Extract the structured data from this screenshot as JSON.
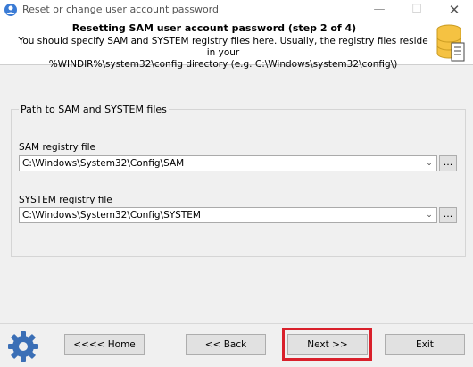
{
  "window": {
    "title": "Reset or change user account password",
    "minimize_symbol": "—",
    "maximize_symbol": "☐",
    "close_symbol": "✕"
  },
  "header": {
    "title": "Resetting SAM user account password (step 2 of 4)",
    "description_line1": "You should specify SAM and SYSTEM registry files here. Usually, the registry files reside in your",
    "description_line2": "%WINDIR%\\system32\\config directory (e.g. C:\\Windows\\system32\\config\\)"
  },
  "group": {
    "legend": "Path to SAM and SYSTEM files",
    "sam": {
      "label": "SAM registry file",
      "value": "C:\\Windows\\System32\\Config\\SAM",
      "browse": "..."
    },
    "system": {
      "label": "SYSTEM registry file",
      "value": "C:\\Windows\\System32\\Config\\SYSTEM",
      "browse": "..."
    }
  },
  "footer": {
    "home": "<<<< Home",
    "back": "<< Back",
    "next": "Next >>",
    "exit": "Exit"
  },
  "colors": {
    "highlight": "#d9202b",
    "db_icon": "#f5c242"
  }
}
